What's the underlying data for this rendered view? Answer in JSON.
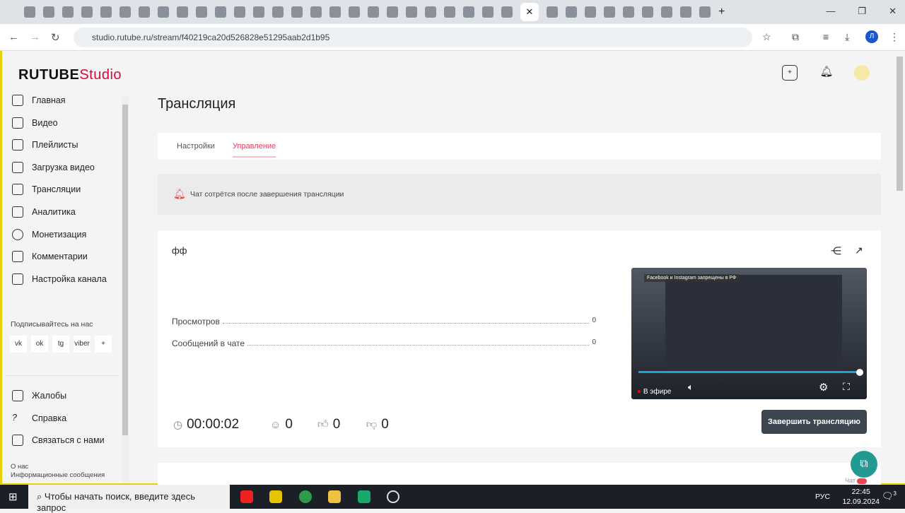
{
  "browser": {
    "url": "studio.rutube.ru/stream/f40219ca20d526828e51295aab2d1b95",
    "active_tab_icon": "close-icon",
    "profile_initial": "Л"
  },
  "logo": {
    "main": "RUTUBE",
    "sub": "Studio"
  },
  "sidebar": {
    "items": [
      {
        "label": "Главная",
        "icon": "home-icon"
      },
      {
        "label": "Видео",
        "icon": "tv-icon"
      },
      {
        "label": "Плейлисты",
        "icon": "playlist-icon"
      },
      {
        "label": "Загрузка видео",
        "icon": "upload-icon"
      },
      {
        "label": "Трансляции",
        "icon": "broadcast-icon"
      },
      {
        "label": "Аналитика",
        "icon": "chart-icon"
      },
      {
        "label": "Монетизация",
        "icon": "coin-icon"
      },
      {
        "label": "Комментарии",
        "icon": "comments-icon"
      },
      {
        "label": "Настройка канала",
        "icon": "settings-icon"
      }
    ],
    "follow_label": "Подписывайтесь на нас",
    "socials": [
      "vk",
      "ok",
      "tg",
      "viber",
      "+"
    ],
    "bottom": [
      {
        "label": "Жалобы"
      },
      {
        "label": "Справка"
      },
      {
        "label": "Связаться с нами"
      }
    ],
    "footer_links": [
      "О нас",
      "Информационные сообщения"
    ]
  },
  "page": {
    "title": "Трансляция",
    "tabs": [
      "Настройки",
      "Управление"
    ],
    "active_tab": 1,
    "notice": "Чат сотрётся после завершения трансляции",
    "stream_name": "фф",
    "stats": [
      {
        "label": "Просмотров",
        "value": "0"
      },
      {
        "label": "Сообщений в чате",
        "value": "0"
      }
    ],
    "duration": "00:00:02",
    "viewers": "0",
    "likes": "0",
    "dislikes": "0",
    "live_label": "В эфире",
    "end_button": "Завершить трансляцию",
    "player_caption": "Facebook и Instagram запрещены в РФ",
    "chat_label": "Чат"
  },
  "taskbar": {
    "search_placeholder": "Чтобы начать поиск, введите здесь запрос",
    "lang": "РУС",
    "time": "22:45",
    "date": "12.09.2024",
    "notifications": "3"
  }
}
